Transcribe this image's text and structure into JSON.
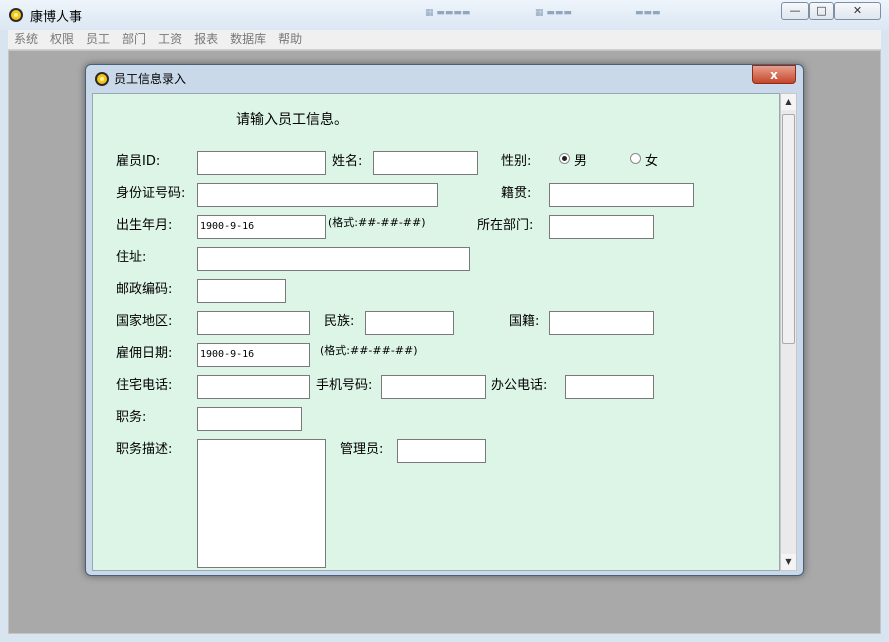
{
  "app": {
    "title": "康博人事",
    "menu": [
      "系统",
      "权限",
      "员工",
      "部门",
      "工资",
      "报表",
      "数据库",
      "帮助"
    ],
    "window_buttons": {
      "minimize": "—",
      "maximize": "□",
      "close": "✕"
    }
  },
  "dialog": {
    "title": "员工信息录入",
    "close_label": "x",
    "prompt": "请输入员工信息。",
    "labels": {
      "employee_id": "雇员ID:",
      "name": "姓名:",
      "gender": "性别:",
      "id_card": "身份证号码:",
      "native_place": "籍贯:",
      "birth_date": "出生年月:",
      "department": "所在部门:",
      "address": "住址:",
      "postal_code": "邮政编码:",
      "region": "国家地区:",
      "ethnicity": "民族:",
      "nationality": "国籍:",
      "hire_date": "雇佣日期:",
      "home_phone": "住宅电话:",
      "mobile": "手机号码:",
      "office_phone": "办公电话:",
      "position": "职务:",
      "position_desc": "职务描述:",
      "manager": "管理员:"
    },
    "gender_options": {
      "male": "男",
      "female": "女",
      "selected": "male"
    },
    "values": {
      "birth_date": "1900-9-16",
      "hire_date": "1900-9-16"
    },
    "hints": {
      "birth_date": "(格式:##-##-##)",
      "hire_date": "(格式:##-##-##)"
    }
  }
}
